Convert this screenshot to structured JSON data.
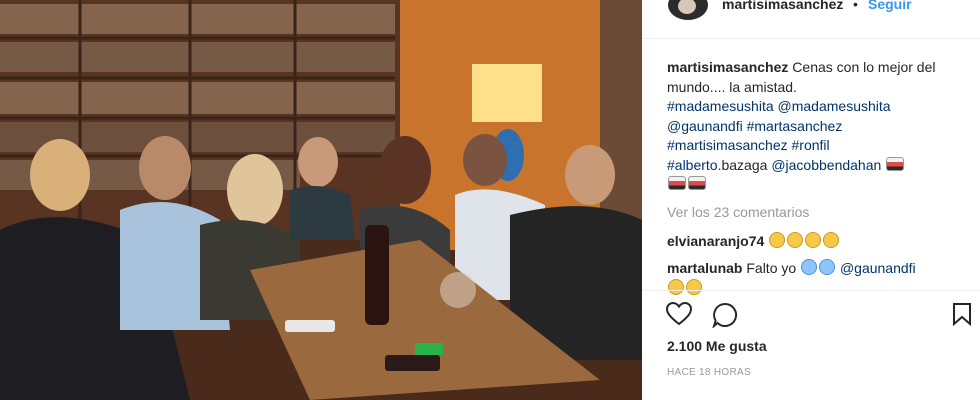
{
  "post": {
    "username": "martisimasanchez",
    "separator": "•",
    "follow_label": "Seguir",
    "caption": {
      "username": "martisimasanchez",
      "text": "Cenas con lo mejor del mundo.... la amistad.",
      "tags_line1_a": "#madamesushita",
      "tags_line1_b": "@madamesushita",
      "tags_line2_a": "@gaunandfi",
      "tags_line2_b": "#martasanchez",
      "tags_line3_a": "#martisimasanchez",
      "tags_line3_b": "#ronfil",
      "tags_line4_a": "#alberto",
      "tags_line4_text": ".bazaga",
      "tags_line4_b": "@jacobbendahan"
    },
    "view_comments": "Ver los 23 comentarios",
    "comments": [
      {
        "username": "elvianaranjo74",
        "text": ""
      },
      {
        "username": "martalunab",
        "text": "Falto yo",
        "mention": "@gaunandfi"
      }
    ],
    "likes": "2.100 Me gusta",
    "time": "HACE 18 HORAS"
  },
  "icons": {
    "like": "heart-icon",
    "comment": "comment-bubble-icon",
    "save": "bookmark-icon"
  },
  "colors": {
    "link": "#003569",
    "follow": "#3897f0",
    "muted": "#999999",
    "text": "#262626"
  }
}
